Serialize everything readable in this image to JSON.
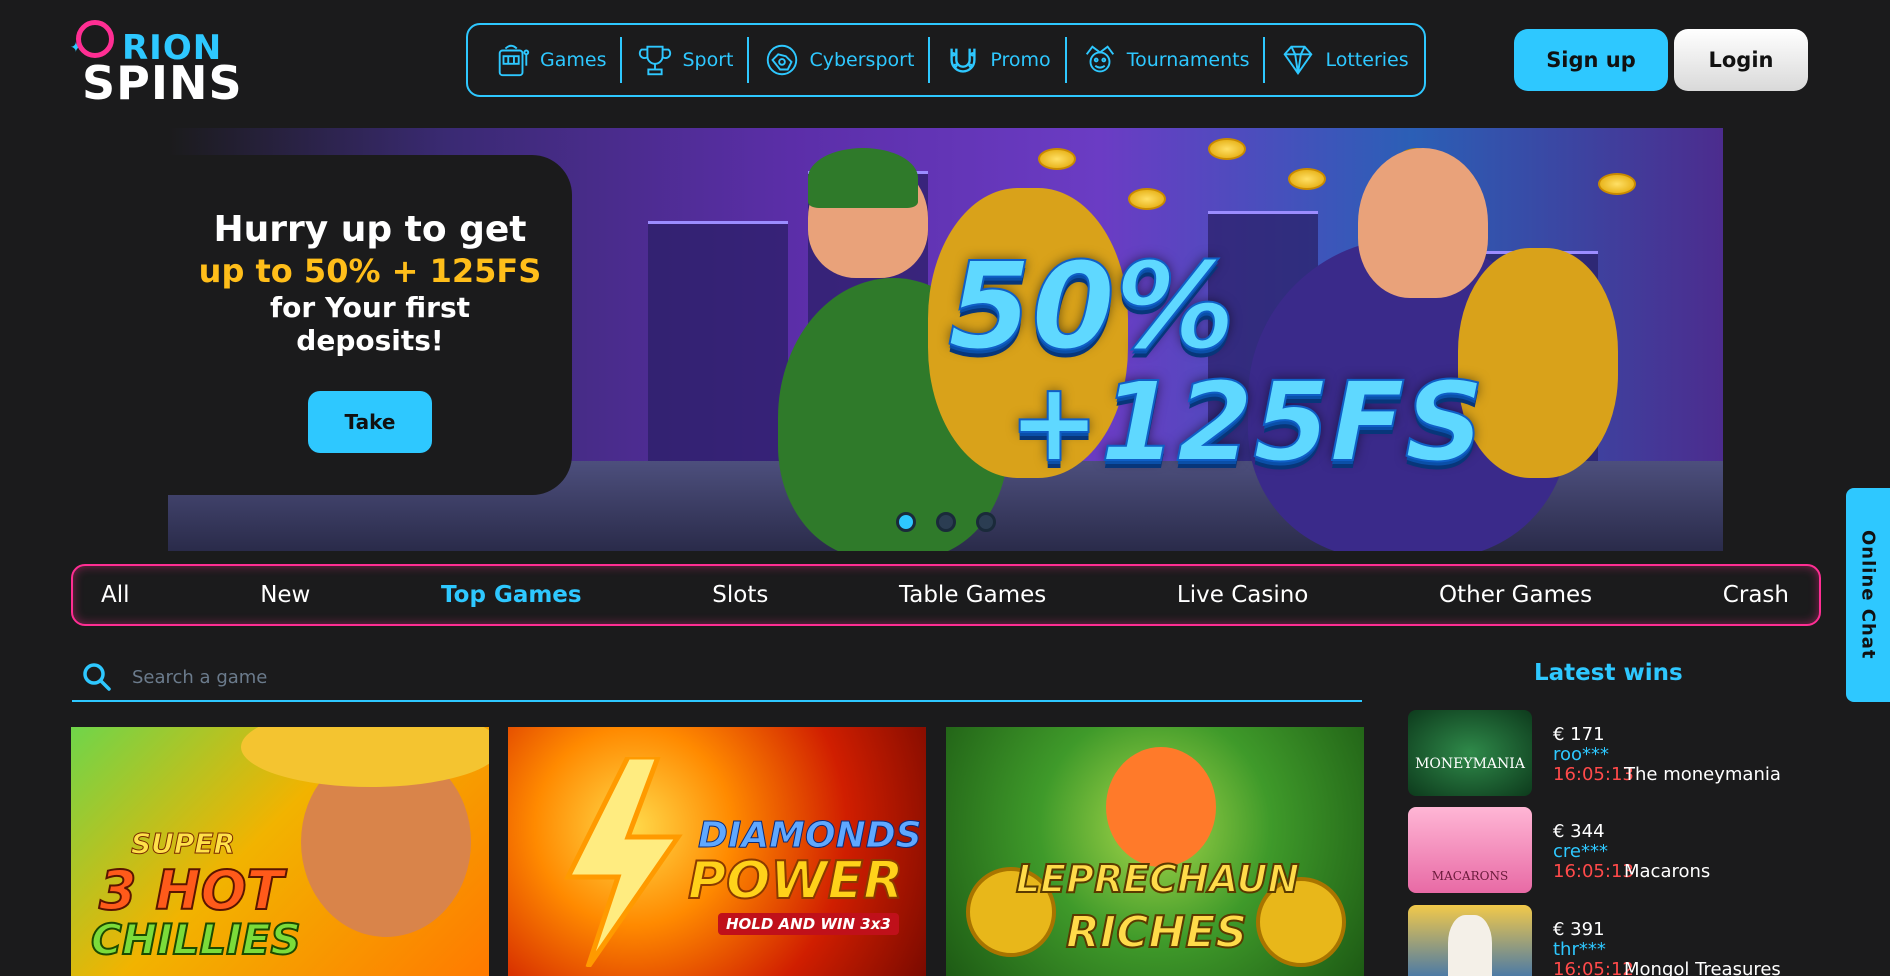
{
  "brand": {
    "line1": "RION",
    "line2": "SPINS"
  },
  "nav": [
    {
      "label": "Games",
      "icon": "slot-machine-icon"
    },
    {
      "label": "Sport",
      "icon": "trophy-icon"
    },
    {
      "label": "Cybersport",
      "icon": "gamepad-icon"
    },
    {
      "label": "Promo",
      "icon": "horseshoe-icon"
    },
    {
      "label": "Tournaments",
      "icon": "jester-icon"
    },
    {
      "label": "Lotteries",
      "icon": "diamond-icon"
    }
  ],
  "auth": {
    "signup_label": "Sign up",
    "login_label": "Login"
  },
  "banner": {
    "line1": "Hurry up to get",
    "line2": "up to 50% + 125FS",
    "line3": "for Your first",
    "line4": "deposits!",
    "cta": "Take",
    "promo_percent": "50%",
    "promo_fs": "+125FS",
    "slides": 3,
    "active_slide": 1
  },
  "categories": [
    "All",
    "New",
    "Top Games",
    "Slots",
    "Table Games",
    "Live Casino",
    "Other Games",
    "Crash"
  ],
  "active_category": "Top Games",
  "search": {
    "placeholder": "Search a game"
  },
  "games": [
    {
      "line1": "SUPER",
      "line2": "3 HOT",
      "line3": "CHILLIES"
    },
    {
      "line1": "DIAMONDS",
      "line2": "POWER",
      "line3": "HOLD AND WIN 3x3"
    },
    {
      "line1": "LEPRECHAUN",
      "line2": "RICHES"
    }
  ],
  "latest_wins": {
    "title": "Latest wins",
    "items": [
      {
        "amount": "€ 171",
        "user": "roo***",
        "time": "16:05:13",
        "game": "The moneymania",
        "thumb_label": "MONEYMANIA"
      },
      {
        "amount": "€ 344",
        "user": "cre***",
        "time": "16:05:13",
        "game": "Macarons",
        "thumb_label": "MACARONS"
      },
      {
        "amount": "€ 391",
        "user": "thr***",
        "time": "16:05:12",
        "game": "Mongol Treasures",
        "thumb_label": ""
      }
    ]
  },
  "chat": {
    "label": "Online Chat"
  },
  "colors": {
    "accent": "#2ec8ff",
    "pink": "#ff2e93",
    "gold": "#ffbe1a",
    "bg": "#1b1b1c",
    "time_red": "#ff4a4a"
  }
}
